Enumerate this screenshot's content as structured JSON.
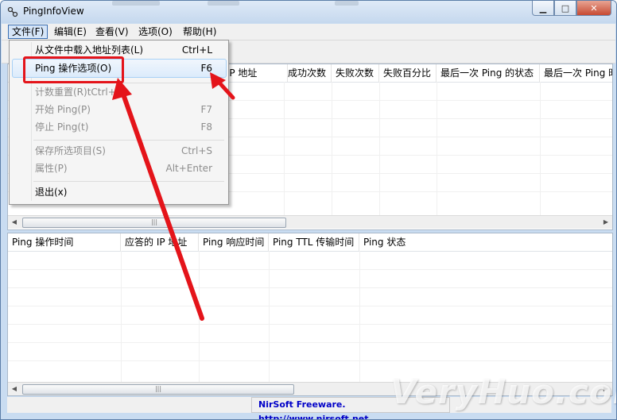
{
  "window": {
    "title": "PingInfoView",
    "minimize_glyph": "▁",
    "maximize_glyph": "□",
    "close_glyph": "✕"
  },
  "menubar": [
    "文件(F)",
    "编辑(E)",
    "查看(V)",
    "选项(O)",
    "帮助(H)"
  ],
  "file_menu": {
    "items": [
      {
        "label": "从文件中载入地址列表(L)",
        "shortcut": "Ctrl+L",
        "enabled": true
      },
      {
        "label": "Ping 操作选项(O)",
        "shortcut": "F6",
        "enabled": true,
        "highlighted": true
      },
      {
        "label": "计数重置(R)tCtrl+R",
        "shortcut": "",
        "enabled": false
      },
      {
        "label": "开始 Ping(P)",
        "shortcut": "F7",
        "enabled": false
      },
      {
        "label": "停止 Ping(t)",
        "shortcut": "F8",
        "enabled": false
      },
      {
        "label": "保存所选项目(S)",
        "shortcut": "Ctrl+S",
        "enabled": false
      },
      {
        "label": "属性(P)",
        "shortcut": "Alt+Enter",
        "enabled": false
      },
      {
        "label": "退出(x)",
        "shortcut": "",
        "enabled": true
      }
    ]
  },
  "top_table": {
    "columns": [
      "的 IP 地址",
      "成功次数",
      "失败次数",
      "失败百分比",
      "最后一次 Ping 的状态",
      "最后一次 Ping 时"
    ]
  },
  "bottom_table": {
    "columns": [
      "Ping 操作时间",
      "应答的 IP 地址",
      "Ping 响应时间",
      "Ping TTL 传输时间",
      "Ping 状态"
    ]
  },
  "scrollbar": {
    "left_arrow": "◀",
    "right_arrow": "▶",
    "grip": "|||"
  },
  "statusbar": {
    "link_text": "NirSoft Freeware.  http://www.nirsoft.net"
  },
  "watermark": "VeryHuo.com",
  "annotation": {
    "color": "#e4141a"
  }
}
